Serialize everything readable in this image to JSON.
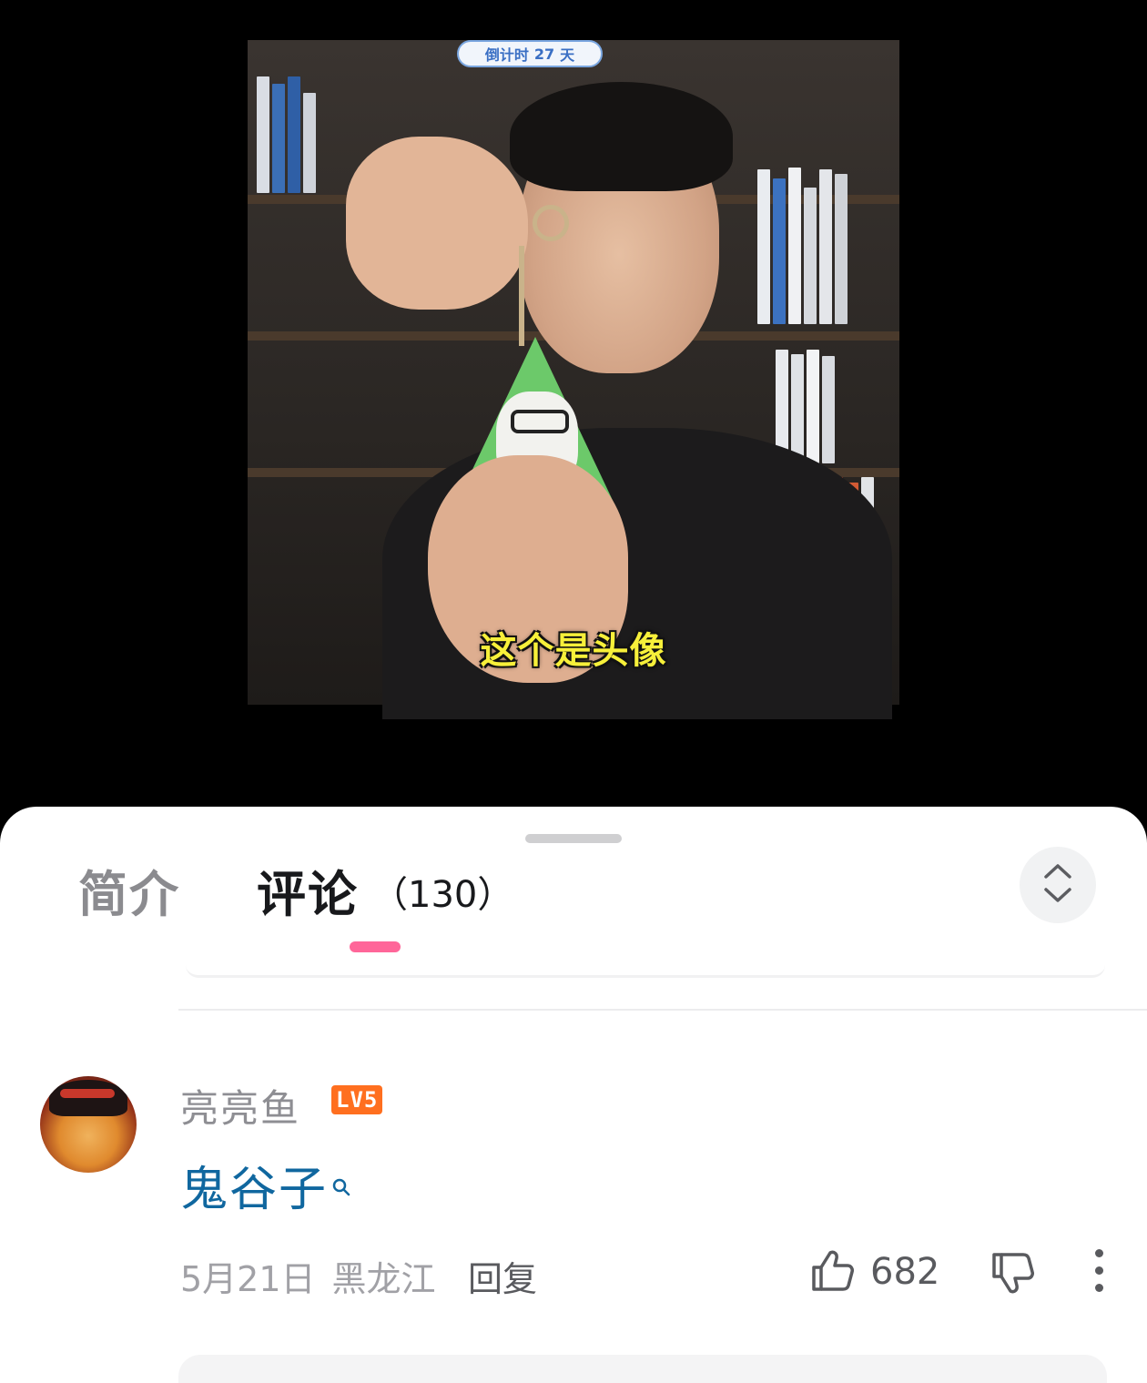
{
  "video": {
    "countdown_label": "倒计时",
    "countdown_days": "27",
    "countdown_unit": "天",
    "subtitle": "这个是头像"
  },
  "sheet": {
    "tabs": [
      {
        "label": "简介",
        "active": false
      },
      {
        "label": "评论",
        "count": "（130）",
        "active": true
      }
    ],
    "accent_color": "#ff6699"
  },
  "comment": {
    "username": "亮亮鱼",
    "level": "LV5",
    "level_color": "#ff6f1f",
    "text": "鬼谷子",
    "link_color": "#10679f",
    "date": "5月21日",
    "location": "黑龙江",
    "reply_label": "回复",
    "like_count": "682",
    "icons": [
      "search-icon",
      "thumbs-up-icon",
      "thumbs-down-icon",
      "more-vertical-icon",
      "expand-collapse-icon"
    ]
  }
}
